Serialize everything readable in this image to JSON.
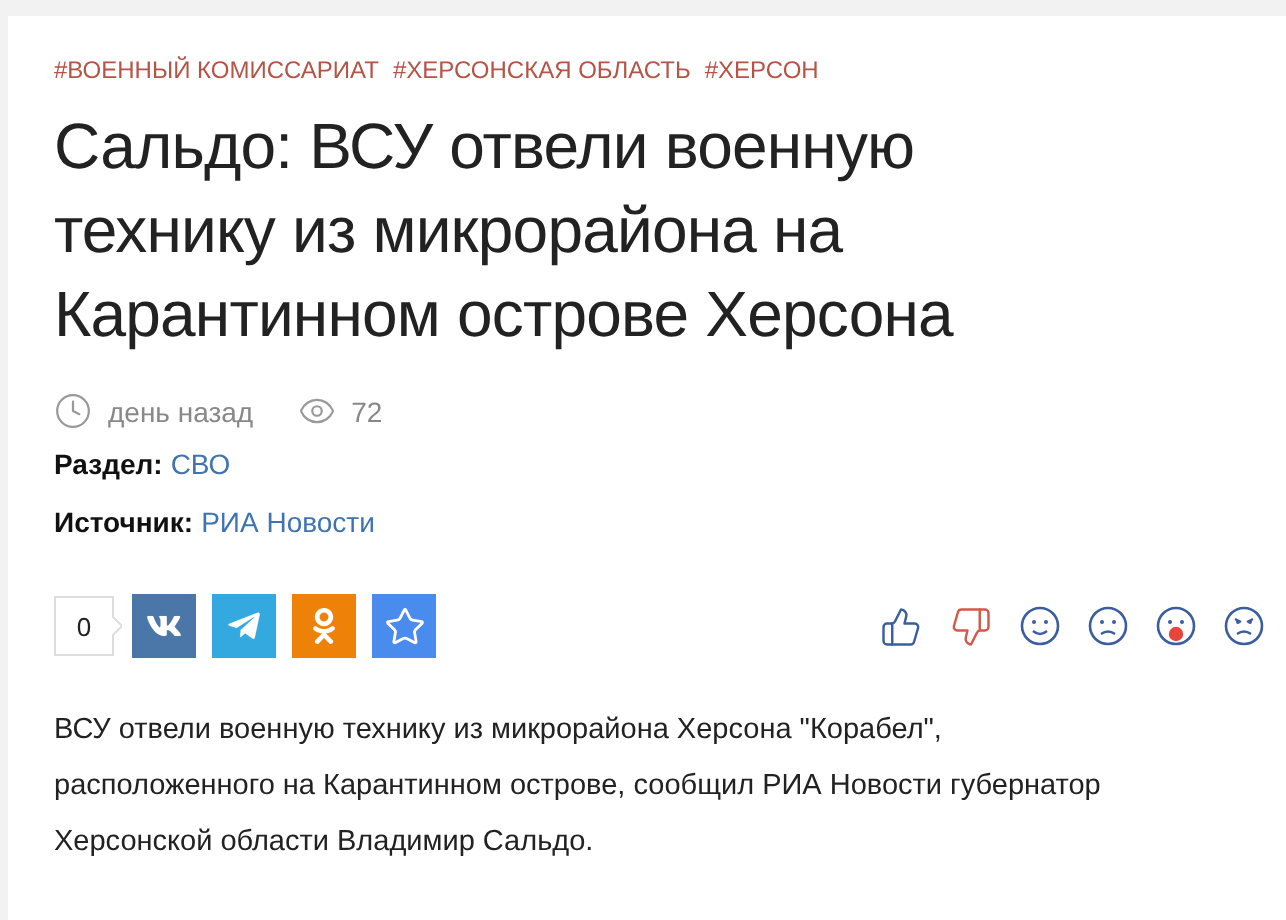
{
  "tags": [
    "#ВОЕННЫЙ КОМИССАРИАТ",
    "#ХЕРСОНСКАЯ ОБЛАСТЬ",
    "#ХЕРСОН"
  ],
  "title": "Сальдо: ВСУ отвели военную технику из микрорайона на Карантинном острове Херсона",
  "meta": {
    "time": "день назад",
    "views": "72"
  },
  "fields": [
    {
      "label": "Раздел:",
      "value": "СВО"
    },
    {
      "label": "Источник:",
      "value": "РИА Новости"
    }
  ],
  "share": {
    "count": "0",
    "buttons": [
      {
        "kind": "vk",
        "color": "#4a76a8"
      },
      {
        "kind": "telegram",
        "color": "#34a9e0"
      },
      {
        "kind": "ok",
        "color": "#ee8208"
      },
      {
        "kind": "favorite",
        "color": "#4a8bee"
      }
    ]
  },
  "reactions": [
    {
      "kind": "like"
    },
    {
      "kind": "dislike"
    },
    {
      "kind": "smile"
    },
    {
      "kind": "sad"
    },
    {
      "kind": "shock"
    },
    {
      "kind": "angry"
    }
  ],
  "body": "ВСУ отвели военную технику из микрорайона Херсона \"Корабел\", расположенного на Карантинном острове, сообщил РИА Новости губернатор Херсонской области Владимир Сальдо."
}
